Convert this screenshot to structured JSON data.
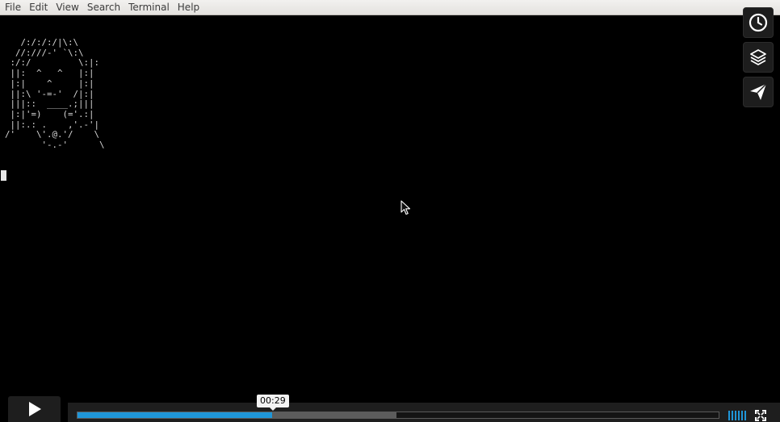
{
  "menu": {
    "file": "File",
    "edit": "Edit",
    "view": "View",
    "search": "Search",
    "terminal": "Terminal",
    "help": "Help"
  },
  "terminal": {
    "ascii_art": "   /:/:/:/|\\:\\\n  //:///-' `\\:\\\n :/:/         \\:|:\n ||:  ^   ^   |:|\n |:|    ^     |:|\n ||:\\ '-=-'  /|:|\n |||::  ____.;|||\n |:|'=)    (='.:|\n ||:.: .    ,'.-'|\n/'    \\'.@.'/    \\\n       '-.-'      \\"
  },
  "side_buttons": {
    "icons": [
      "clock-icon",
      "layers-icon",
      "send-icon"
    ]
  },
  "player": {
    "time_tooltip": "00:29",
    "progress_fraction": 0.303,
    "buffered_fraction": 0.497,
    "accent_color": "#1f96d8"
  }
}
